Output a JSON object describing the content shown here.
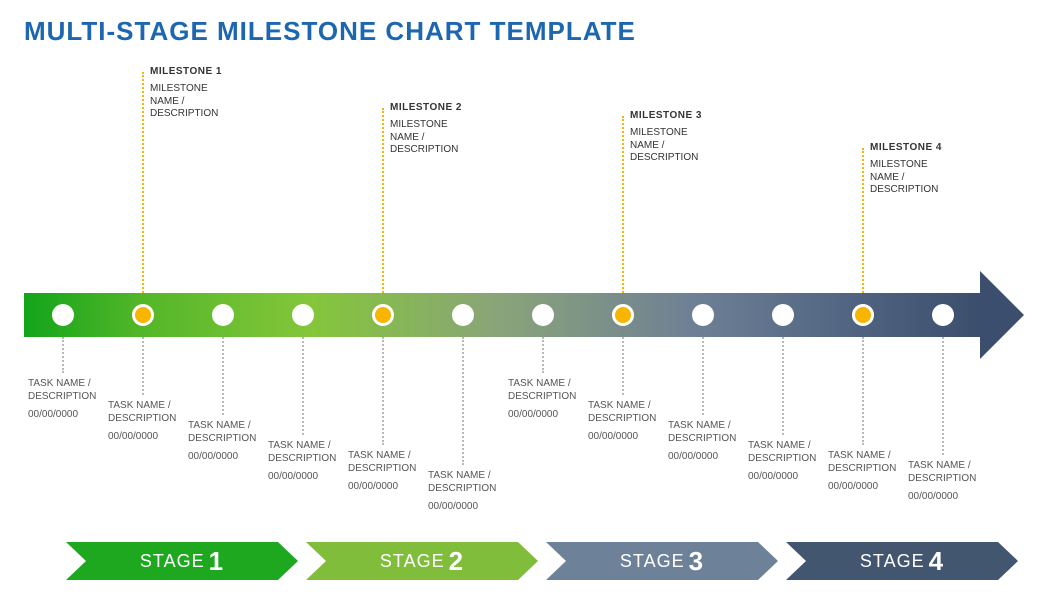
{
  "title": "MULTI-STAGE MILESTONE CHART TEMPLATE",
  "milestones": [
    {
      "hd": "MILESTONE 1",
      "desc": "MILESTONE\nNAME /\nDESCRIPTION"
    },
    {
      "hd": "MILESTONE 2",
      "desc": "MILESTONE\nNAME /\nDESCRIPTION"
    },
    {
      "hd": "MILESTONE 3",
      "desc": "MILESTONE\nNAME /\nDESCRIPTION"
    },
    {
      "hd": "MILESTONE 4",
      "desc": "MILESTONE\nNAME /\nDESCRIPTION"
    }
  ],
  "tasks": [
    {
      "nm": "TASK NAME /\nDESCRIPTION",
      "dt": "00/00/0000"
    },
    {
      "nm": "TASK NAME /\nDESCRIPTION",
      "dt": "00/00/0000"
    },
    {
      "nm": "TASK NAME /\nDESCRIPTION",
      "dt": "00/00/0000"
    },
    {
      "nm": "TASK NAME /\nDESCRIPTION",
      "dt": "00/00/0000"
    },
    {
      "nm": "TASK NAME /\nDESCRIPTION",
      "dt": "00/00/0000"
    },
    {
      "nm": "TASK NAME /\nDESCRIPTION",
      "dt": "00/00/0000"
    },
    {
      "nm": "TASK NAME /\nDESCRIPTION",
      "dt": "00/00/0000"
    },
    {
      "nm": "TASK NAME /\nDESCRIPTION",
      "dt": "00/00/0000"
    },
    {
      "nm": "TASK NAME /\nDESCRIPTION",
      "dt": "00/00/0000"
    },
    {
      "nm": "TASK NAME /\nDESCRIPTION",
      "dt": "00/00/0000"
    },
    {
      "nm": "TASK NAME /\nDESCRIPTION",
      "dt": "00/00/0000"
    },
    {
      "nm": "TASK NAME /\nDESCRIPTION",
      "dt": "00/00/0000"
    }
  ],
  "stages": [
    {
      "word": "STAGE",
      "num": "1",
      "color": "#1da81f"
    },
    {
      "word": "STAGE",
      "num": "2",
      "color": "#7fbd3a"
    },
    {
      "word": "STAGE",
      "num": "3",
      "color": "#6d8299"
    },
    {
      "word": "STAGE",
      "num": "4",
      "color": "#435670"
    }
  ],
  "chart_data": {
    "type": "timeline",
    "title": "MULTI-STAGE MILESTONE CHART TEMPLATE",
    "stages": [
      "STAGE 1",
      "STAGE 2",
      "STAGE 3",
      "STAGE 4"
    ],
    "dots_total": 12,
    "dots_milestone_indices": [
      1,
      4,
      7,
      10
    ],
    "milestones": [
      {
        "label": "MILESTONE 1",
        "subtitle": "MILESTONE NAME / DESCRIPTION",
        "dot_index": 1
      },
      {
        "label": "MILESTONE 2",
        "subtitle": "MILESTONE NAME / DESCRIPTION",
        "dot_index": 4
      },
      {
        "label": "MILESTONE 3",
        "subtitle": "MILESTONE NAME / DESCRIPTION",
        "dot_index": 7
      },
      {
        "label": "MILESTONE 4",
        "subtitle": "MILESTONE NAME / DESCRIPTION",
        "dot_index": 10
      }
    ],
    "tasks": [
      {
        "dot_index": 0,
        "name": "TASK NAME / DESCRIPTION",
        "date": "00/00/0000"
      },
      {
        "dot_index": 1,
        "name": "TASK NAME / DESCRIPTION",
        "date": "00/00/0000"
      },
      {
        "dot_index": 2,
        "name": "TASK NAME / DESCRIPTION",
        "date": "00/00/0000"
      },
      {
        "dot_index": 3,
        "name": "TASK NAME / DESCRIPTION",
        "date": "00/00/0000"
      },
      {
        "dot_index": 4,
        "name": "TASK NAME / DESCRIPTION",
        "date": "00/00/0000"
      },
      {
        "dot_index": 5,
        "name": "TASK NAME / DESCRIPTION",
        "date": "00/00/0000"
      },
      {
        "dot_index": 6,
        "name": "TASK NAME / DESCRIPTION",
        "date": "00/00/0000"
      },
      {
        "dot_index": 7,
        "name": "TASK NAME / DESCRIPTION",
        "date": "00/00/0000"
      },
      {
        "dot_index": 8,
        "name": "TASK NAME / DESCRIPTION",
        "date": "00/00/0000"
      },
      {
        "dot_index": 9,
        "name": "TASK NAME / DESCRIPTION",
        "date": "00/00/0000"
      },
      {
        "dot_index": 10,
        "name": "TASK NAME / DESCRIPTION",
        "date": "00/00/0000"
      },
      {
        "dot_index": 11,
        "name": "TASK NAME / DESCRIPTION",
        "date": "00/00/0000"
      }
    ]
  }
}
